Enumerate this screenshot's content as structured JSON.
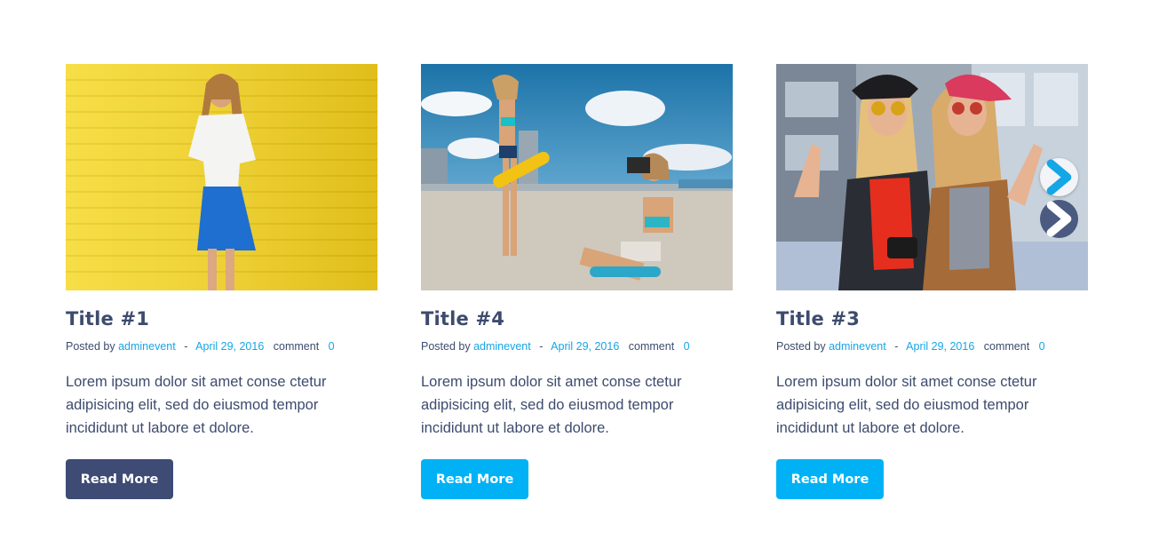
{
  "posts": [
    {
      "title": "Title #1",
      "posted_by_label": "Posted by",
      "author": "adminevent",
      "separator": "-",
      "date": "April 29, 2016",
      "comment_label": "comment",
      "comment_count": "0",
      "excerpt": "Lorem ipsum dolor sit amet conse ctetur adipisicing elit, sed do eiusmod tempor incididunt ut labore et dolore.",
      "button_label": "Read More",
      "image": "woman-against-yellow-brick-wall"
    },
    {
      "title": "Title #4",
      "posted_by_label": "Posted by",
      "author": "adminevent",
      "separator": "-",
      "date": "April 29, 2016",
      "comment_label": "comment",
      "comment_count": "0",
      "excerpt": "Lorem ipsum dolor sit amet conse ctetur adipisicing elit, sed do eiusmod tempor incididunt ut labore et dolore.",
      "button_label": "Read More",
      "image": "skateboarders-photographing-under-blue-sky"
    },
    {
      "title": "Title #3",
      "posted_by_label": "Posted by",
      "author": "adminevent",
      "separator": "-",
      "date": "April 29, 2016",
      "comment_label": "comment",
      "comment_count": "0",
      "excerpt": "Lorem ipsum dolor sit amet conse ctetur adipisicing elit, sed do eiusmod tempor incididunt ut labore et dolore.",
      "button_label": "Read More",
      "image": "two-friends-with-caps-and-sunglasses"
    }
  ],
  "carousel": {
    "next_icon": "chevron-right-icon",
    "prev_icon": "chevron-right-icon"
  },
  "colors": {
    "text": "#3d4b6e",
    "link": "#15a6e6",
    "button_active": "#3d4b75",
    "button_default": "#00b2f5"
  }
}
